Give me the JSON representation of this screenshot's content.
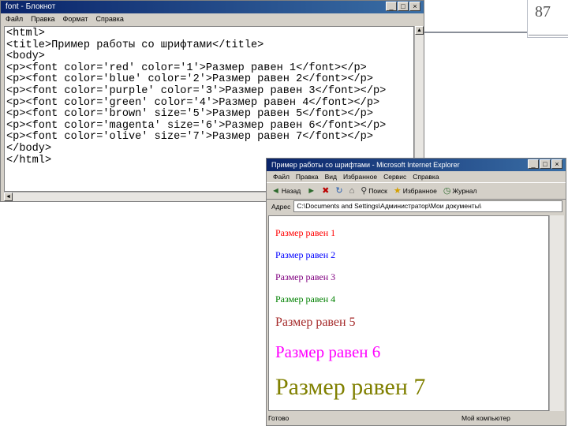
{
  "slide": {
    "number": "87"
  },
  "notepad": {
    "title": "font - Блокнот",
    "menu": [
      "Файл",
      "Правка",
      "Формат",
      "Справка"
    ],
    "code": "<html>\n<title>Пример работы со шрифтами</title>\n<body>\n<p><font color='red' color='1'>Размер равен 1</font></p>\n<p><font color='blue' color='2'>Размер равен 2</font></p>\n<p><font color='purple' color='3'>Размер равен 3</font></p>\n<p><font color='green' color='4'>Размер равен 4</font></p>\n<p><font color='brown' size='5'>Размер равен 5</font></p>\n<p><font color='magenta' size='6'>Размер равен 6</font></p>\n<p><font color='olive' size='7'>Размер равен 7</font></p>\n</body>\n</html>"
  },
  "ie": {
    "title": "Пример работы со шрифтами - Microsoft Internet Explorer",
    "menu": [
      "Файл",
      "Правка",
      "Вид",
      "Избранное",
      "Сервис",
      "Справка"
    ],
    "toolbar": {
      "back": "Назад",
      "search": "Поиск",
      "favorites": "Избранное",
      "journal": "Журнал"
    },
    "address_label": "Адрес",
    "address_value": "C:\\Documents and Settings\\Администратор\\Мои документы\\",
    "status_left": "Готово",
    "status_right": "Мой компьютер",
    "lines": [
      {
        "text": "Размер равен 1",
        "color": "#ff0000"
      },
      {
        "text": "Размер равен 2",
        "color": "#0000ff"
      },
      {
        "text": "Размер равен 3",
        "color": "#800080"
      },
      {
        "text": "Размер равен 4",
        "color": "#008000"
      },
      {
        "text": "Размер равен 5",
        "color": "#a52a2a"
      },
      {
        "text": "Размер равен 6",
        "color": "#ff00ff"
      },
      {
        "text": "Размер равен 7",
        "color": "#808000"
      }
    ]
  }
}
